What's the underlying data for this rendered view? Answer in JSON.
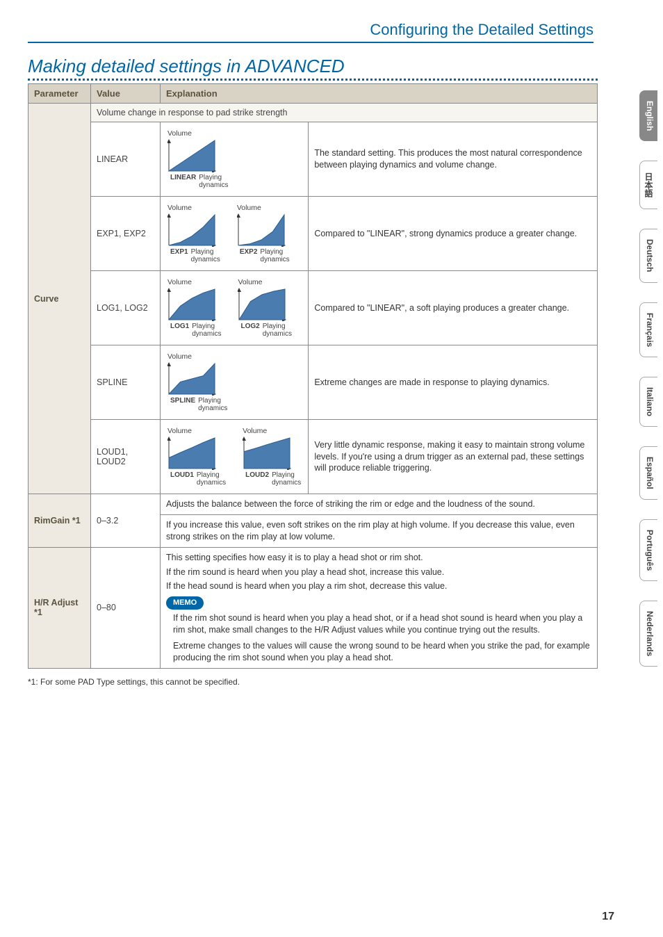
{
  "header_link": "Configuring the Detailed Settings",
  "section_title": "Making detailed settings in ADVANCED",
  "columns": {
    "param": "Parameter",
    "value": "Value",
    "expl": "Explanation"
  },
  "curve": {
    "param_label": "Curve",
    "span_header": "Volume change in response to pad strike strength",
    "chart_labels": {
      "y": "Volume",
      "x1": "Playing",
      "x2": "dynamics"
    },
    "rows": [
      {
        "value": "LINEAR",
        "charts": [
          "LINEAR"
        ],
        "explanation": "The standard setting. This produces the most natural correspondence between playing dynamics and volume change."
      },
      {
        "value": "EXP1, EXP2",
        "charts": [
          "EXP1",
          "EXP2"
        ],
        "explanation": "Compared to \"LINEAR\", strong dynamics produce a greater change."
      },
      {
        "value": "LOG1, LOG2",
        "charts": [
          "LOG1",
          "LOG2"
        ],
        "explanation": "Compared to \"LINEAR\", a soft playing produces a greater change."
      },
      {
        "value": "SPLINE",
        "charts": [
          "SPLINE"
        ],
        "explanation": "Extreme changes are made in response to playing dynamics."
      },
      {
        "value": "LOUD1, LOUD2",
        "charts": [
          "LOUD1",
          "LOUD2"
        ],
        "explanation": "Very little dynamic response, making it easy to maintain strong volume levels. If you're using a drum trigger as an external pad, these settings will produce reliable triggering."
      }
    ]
  },
  "rimgain": {
    "param_label": "RimGain *1",
    "value": "0–3.2",
    "line1": "Adjusts the balance between the force of striking the rim or edge and the loudness of the sound.",
    "line2": "If you increase this value, even soft strikes on the rim play at high volume. If you decrease this value, even strong strikes on the rim play at low volume."
  },
  "hradjust": {
    "param_label": "H/R Adjust *1",
    "value": "0–80",
    "p1": "This setting specifies how easy it is to play a head shot or rim shot.",
    "p2": "If the rim sound is heard when you play a head shot, increase this value.",
    "p3": "If the head sound is heard when you play a rim shot, decrease this value.",
    "memo_label": "MEMO",
    "memo1": "If the rim shot sound is heard when you play a head shot, or if a head shot sound is heard when you play a rim shot, make small changes to the H/R Adjust values while you continue trying out the results.",
    "memo2": "Extreme changes to the values will cause the wrong sound to be heard when you strike the pad, for example producing the rim shot sound when you play a head shot."
  },
  "footnote": "*1: For some PAD Type settings, this cannot be specified.",
  "page_number": "17",
  "lang_tabs": [
    "English",
    "日本語",
    "Deutsch",
    "Français",
    "Italiano",
    "Español",
    "Português",
    "Nederlands"
  ],
  "chart_data": [
    {
      "type": "line",
      "name": "LINEAR",
      "xlabel": "Playing dynamics",
      "ylabel": "Volume",
      "x": [
        0,
        0.25,
        0.5,
        0.75,
        1
      ],
      "y": [
        0,
        0.25,
        0.5,
        0.75,
        1
      ],
      "xlim": [
        0,
        1
      ],
      "ylim": [
        0,
        1
      ]
    },
    {
      "type": "line",
      "name": "EXP1",
      "xlabel": "Playing dynamics",
      "ylabel": "Volume",
      "x": [
        0,
        0.25,
        0.5,
        0.75,
        1
      ],
      "y": [
        0,
        0.1,
        0.3,
        0.6,
        1
      ],
      "xlim": [
        0,
        1
      ],
      "ylim": [
        0,
        1
      ]
    },
    {
      "type": "line",
      "name": "EXP2",
      "xlabel": "Playing dynamics",
      "ylabel": "Volume",
      "x": [
        0,
        0.25,
        0.5,
        0.75,
        1
      ],
      "y": [
        0,
        0.05,
        0.18,
        0.45,
        1
      ],
      "xlim": [
        0,
        1
      ],
      "ylim": [
        0,
        1
      ]
    },
    {
      "type": "line",
      "name": "LOG1",
      "xlabel": "Playing dynamics",
      "ylabel": "Volume",
      "x": [
        0,
        0.25,
        0.5,
        0.75,
        1
      ],
      "y": [
        0,
        0.45,
        0.7,
        0.88,
        1
      ],
      "xlim": [
        0,
        1
      ],
      "ylim": [
        0,
        1
      ]
    },
    {
      "type": "line",
      "name": "LOG2",
      "xlabel": "Playing dynamics",
      "ylabel": "Volume",
      "x": [
        0,
        0.25,
        0.5,
        0.75,
        1
      ],
      "y": [
        0,
        0.6,
        0.82,
        0.93,
        1
      ],
      "xlim": [
        0,
        1
      ],
      "ylim": [
        0,
        1
      ]
    },
    {
      "type": "line",
      "name": "SPLINE",
      "xlabel": "Playing dynamics",
      "ylabel": "Volume",
      "x": [
        0,
        0.25,
        0.5,
        0.75,
        1
      ],
      "y": [
        0,
        0.4,
        0.5,
        0.6,
        1
      ],
      "xlim": [
        0,
        1
      ],
      "ylim": [
        0,
        1
      ]
    },
    {
      "type": "line",
      "name": "LOUD1",
      "xlabel": "Playing dynamics",
      "ylabel": "Volume",
      "x": [
        0,
        0.25,
        0.5,
        0.75,
        1
      ],
      "y": [
        0.35,
        0.52,
        0.68,
        0.85,
        1
      ],
      "xlim": [
        0,
        1
      ],
      "ylim": [
        0,
        1
      ]
    },
    {
      "type": "line",
      "name": "LOUD2",
      "xlabel": "Playing dynamics",
      "ylabel": "Volume",
      "x": [
        0,
        0.25,
        0.5,
        0.75,
        1
      ],
      "y": [
        0.55,
        0.66,
        0.78,
        0.89,
        1
      ],
      "xlim": [
        0,
        1
      ],
      "ylim": [
        0,
        1
      ]
    }
  ]
}
